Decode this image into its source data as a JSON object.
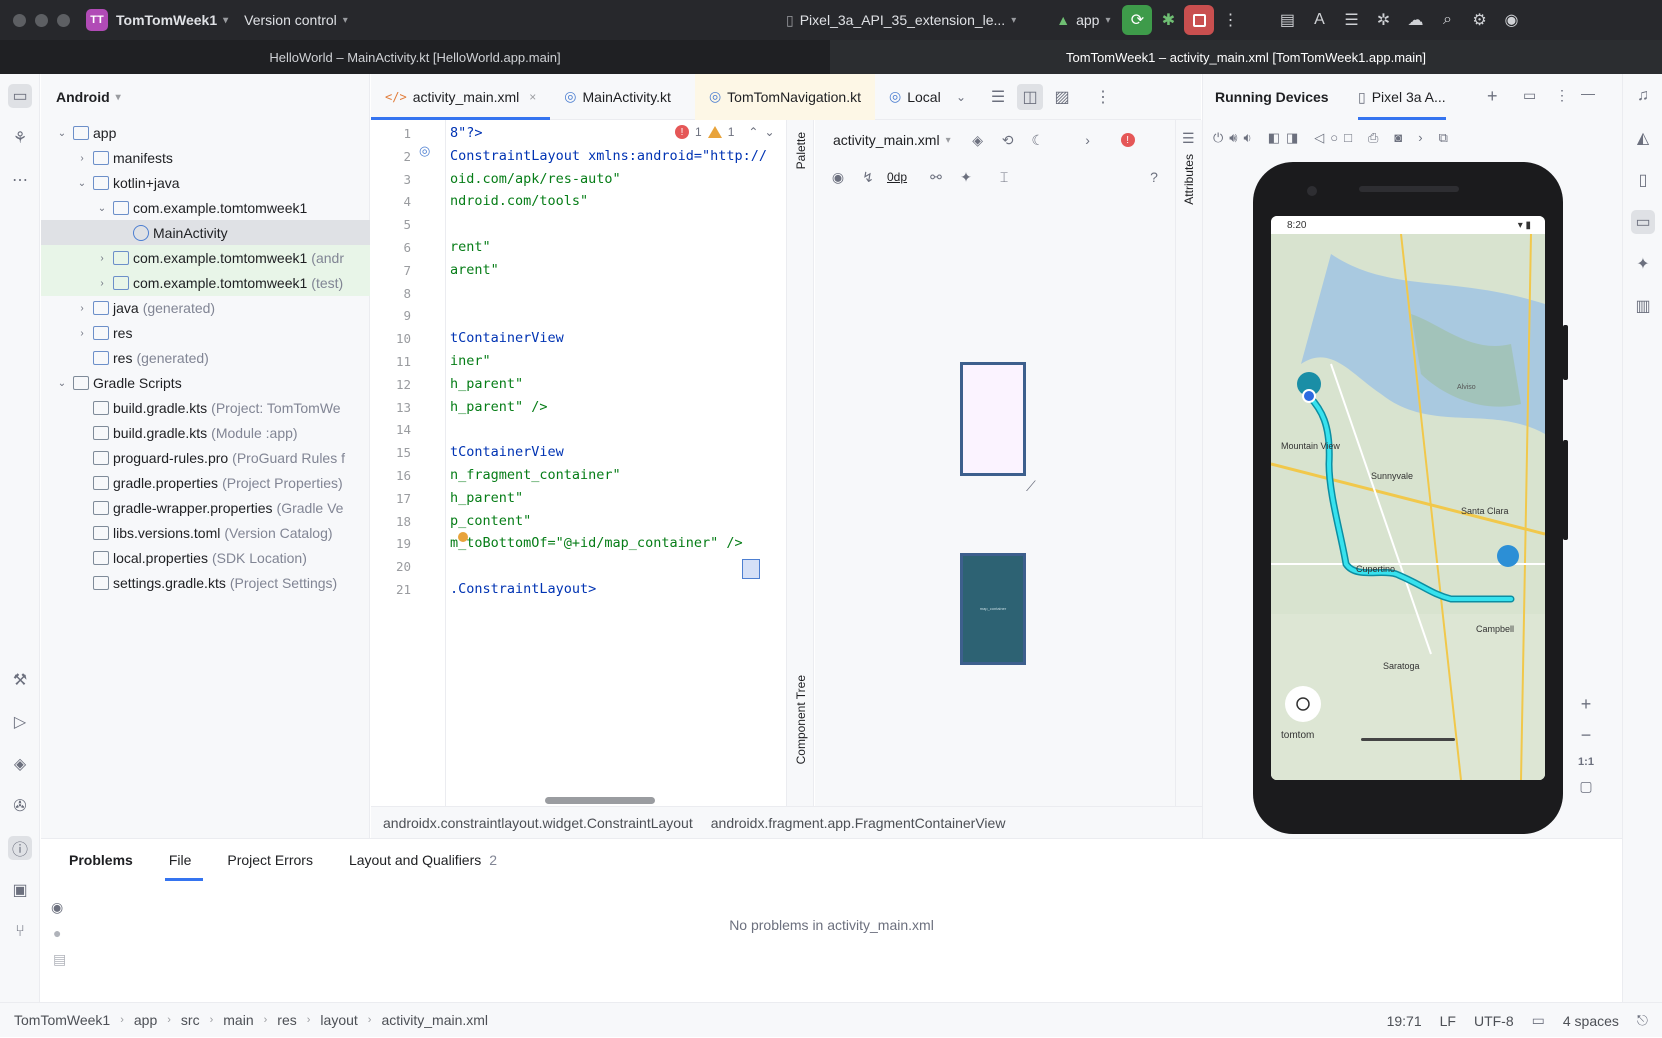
{
  "titlebar": {
    "project_badge": "TT",
    "project": "TomTomWeek1",
    "vcs": "Version control",
    "device": "Pixel_3a_API_35_extension_le...",
    "run_config": "app"
  },
  "window_tabs": [
    "HelloWorld – MainActivity.kt [HelloWorld.app.main]",
    "TomTomWeek1 – activity_main.xml [TomTomWeek1.app.main]"
  ],
  "project_panel": {
    "title": "Android",
    "tree": [
      {
        "label": "app",
        "hint": "",
        "indent": 0,
        "arrow": "v",
        "icon": "folder"
      },
      {
        "label": "manifests",
        "hint": "",
        "indent": 1,
        "arrow": ">",
        "icon": "folder"
      },
      {
        "label": "kotlin+java",
        "hint": "",
        "indent": 1,
        "arrow": "v",
        "icon": "folder"
      },
      {
        "label": "com.example.tomtomweek1",
        "hint": "",
        "indent": 2,
        "arrow": "v",
        "icon": "package"
      },
      {
        "label": "MainActivity",
        "hint": "",
        "indent": 3,
        "arrow": "",
        "icon": "kotlin"
      },
      {
        "label": "com.example.tomtomweek1",
        "hint": "(andr",
        "indent": 2,
        "arrow": ">",
        "icon": "package"
      },
      {
        "label": "com.example.tomtomweek1",
        "hint": "(test)",
        "indent": 2,
        "arrow": ">",
        "icon": "package"
      },
      {
        "label": "java",
        "hint": "(generated)",
        "indent": 1,
        "arrow": ">",
        "icon": "folder"
      },
      {
        "label": "res",
        "hint": "",
        "indent": 1,
        "arrow": ">",
        "icon": "folder"
      },
      {
        "label": "res",
        "hint": "(generated)",
        "indent": 1,
        "arrow": "",
        "icon": "folder"
      },
      {
        "label": "Gradle Scripts",
        "hint": "",
        "indent": 0,
        "arrow": "v",
        "icon": "gradle"
      },
      {
        "label": "build.gradle.kts",
        "hint": "(Project: TomTomWe",
        "indent": 1,
        "arrow": "",
        "icon": "gradle"
      },
      {
        "label": "build.gradle.kts",
        "hint": "(Module :app)",
        "indent": 1,
        "arrow": "",
        "icon": "gradle"
      },
      {
        "label": "proguard-rules.pro",
        "hint": "(ProGuard Rules f",
        "indent": 1,
        "arrow": "",
        "icon": "file"
      },
      {
        "label": "gradle.properties",
        "hint": "(Project Properties)",
        "indent": 1,
        "arrow": "",
        "icon": "gear"
      },
      {
        "label": "gradle-wrapper.properties",
        "hint": "(Gradle Ve",
        "indent": 1,
        "arrow": "",
        "icon": "gear"
      },
      {
        "label": "libs.versions.toml",
        "hint": "(Version Catalog)",
        "indent": 1,
        "arrow": "",
        "icon": "toml"
      },
      {
        "label": "local.properties",
        "hint": "(SDK Location)",
        "indent": 1,
        "arrow": "",
        "icon": "gear"
      },
      {
        "label": "settings.gradle.kts",
        "hint": "(Project Settings)",
        "indent": 1,
        "arrow": "",
        "icon": "gradle"
      }
    ]
  },
  "editor_tabs": [
    {
      "label": "activity_main.xml",
      "active": true,
      "close": "×"
    },
    {
      "label": "MainActivity.kt",
      "active": false,
      "close": ""
    },
    {
      "label": "TomTomNavigation.kt",
      "active": false,
      "close": ""
    },
    {
      "label": "Local",
      "active": false,
      "close": ""
    }
  ],
  "inspections": {
    "errors": "1",
    "warnings": "1"
  },
  "code_lines": [
    {
      "n": "1",
      "t": "8\"?>",
      "c": "tag"
    },
    {
      "n": "2",
      "t": "ConstraintLayout xmlns:android=\"http://",
      "c": "tag"
    },
    {
      "n": "3",
      "t": "oid.com/apk/res-auto\"",
      "c": "str"
    },
    {
      "n": "4",
      "t": "ndroid.com/tools\"",
      "c": "str"
    },
    {
      "n": "5",
      "t": "",
      "c": "str"
    },
    {
      "n": "6",
      "t": "rent\"",
      "c": "str"
    },
    {
      "n": "7",
      "t": "arent\"",
      "c": "str"
    },
    {
      "n": "8",
      "t": "",
      "c": "str"
    },
    {
      "n": "9",
      "t": "",
      "c": "str"
    },
    {
      "n": "10",
      "t": "tContainerView",
      "c": "tag"
    },
    {
      "n": "11",
      "t": "iner\"",
      "c": "str"
    },
    {
      "n": "12",
      "t": "h_parent\"",
      "c": "str"
    },
    {
      "n": "13",
      "t": "h_parent\" />",
      "c": "str"
    },
    {
      "n": "14",
      "t": "",
      "c": "str"
    },
    {
      "n": "15",
      "t": "tContainerView",
      "c": "tag"
    },
    {
      "n": "16",
      "t": "n_fragment_container\"",
      "c": "str"
    },
    {
      "n": "17",
      "t": "h_parent\"",
      "c": "str"
    },
    {
      "n": "18",
      "t": "p_content\"",
      "c": "str"
    },
    {
      "n": "19",
      "t": "m_toBottomOf=\"@+id/map_container\" />",
      "c": "str"
    },
    {
      "n": "20",
      "t": "",
      "c": "str"
    },
    {
      "n": "21",
      "t": ".ConstraintLayout>",
      "c": "tag"
    }
  ],
  "design": {
    "file": "activity_main.xml",
    "margin": "0dp",
    "palette": "Palette",
    "component_tree": "Component Tree",
    "attributes": "Attributes",
    "blueprint_label": "map_container"
  },
  "breadcrumb": [
    "androidx.constraintlayout.widget.ConstraintLayout",
    "androidx.fragment.app.FragmentContainerView"
  ],
  "devices": {
    "title": "Running Devices",
    "tab": "Pixel 3a A...",
    "status_time": "8:20",
    "map_labels": [
      "Mountain View",
      "Sunnyvale",
      "Santa Clara",
      "Cupertino",
      "Campbell",
      "Saratoga",
      "Alviso"
    ],
    "brand": "tomtom",
    "zoom_ratio": "1:1"
  },
  "bottom": {
    "tabs": [
      {
        "label": "Problems",
        "count": ""
      },
      {
        "label": "File",
        "count": ""
      },
      {
        "label": "Project Errors",
        "count": ""
      },
      {
        "label": "Layout and Qualifiers",
        "count": "2"
      }
    ],
    "message": "No problems in activity_main.xml"
  },
  "status": {
    "path": [
      "TomTomWeek1",
      "app",
      "src",
      "main",
      "res",
      "layout",
      "activity_main.xml"
    ],
    "position": "19:71",
    "eol": "LF",
    "encoding": "UTF-8",
    "indent": "4 spaces"
  }
}
